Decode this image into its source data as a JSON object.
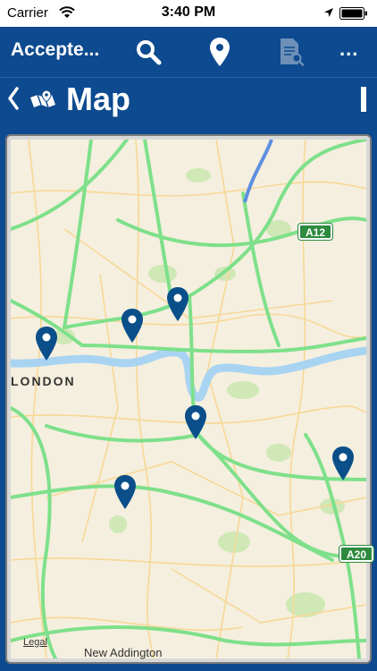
{
  "status_bar": {
    "carrier": "Carrier",
    "time": "3:40 PM"
  },
  "app_bar": {
    "title": "Accepte...",
    "more_label": "..."
  },
  "page_header": {
    "title": "Map"
  },
  "map": {
    "place_label": "LONDON",
    "legal_label": "Legal",
    "bottom_label": "New Addington",
    "road_shields": [
      "A12",
      "A20"
    ],
    "accent_color": "#0d4a8f",
    "pin_color": "#0b4f8a",
    "road_color": "#7ee08a"
  }
}
